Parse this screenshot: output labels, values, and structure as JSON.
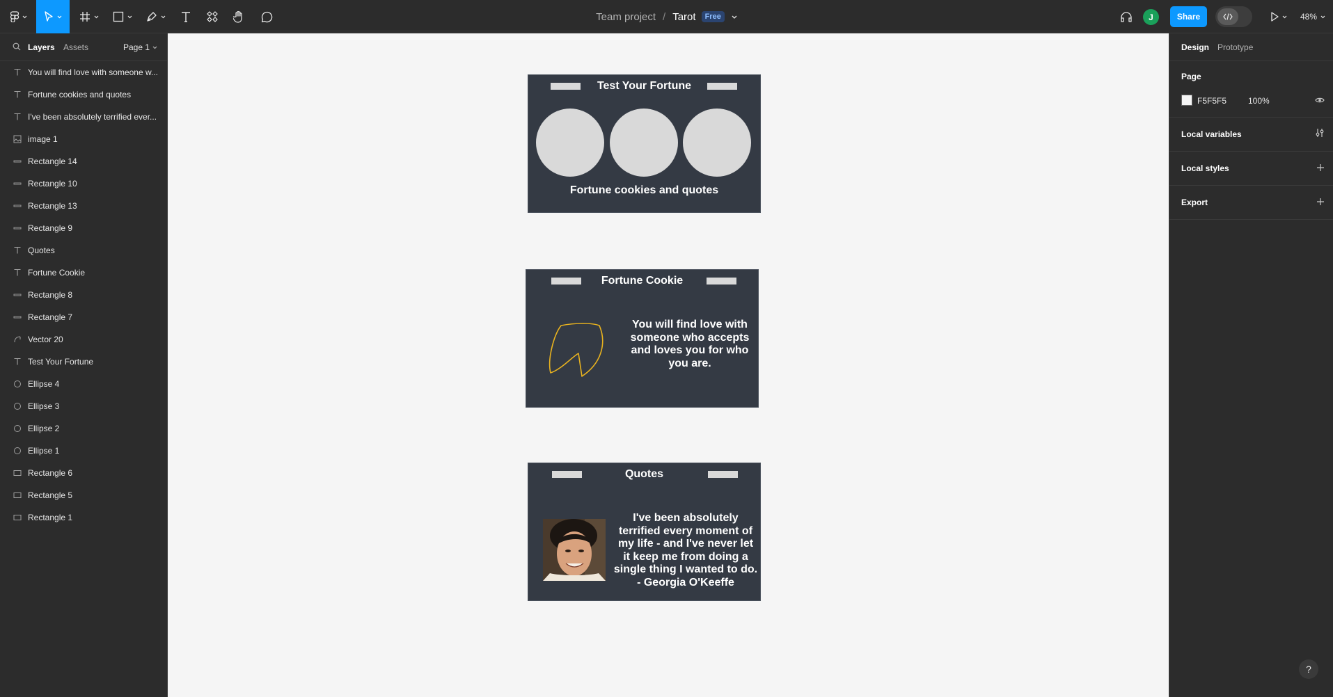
{
  "toolbar": {
    "tools": [
      "main-menu",
      "move",
      "frame",
      "shape",
      "pen",
      "text",
      "resources",
      "hand",
      "comment"
    ],
    "team": "Team project",
    "separator": "/",
    "file_name": "Tarot",
    "plan_badge": "Free",
    "avatar_initial": "J",
    "share_label": "Share",
    "zoom": "48%"
  },
  "left_panel": {
    "tabs": {
      "layers": "Layers",
      "assets": "Assets"
    },
    "page_selector": "Page 1",
    "layers": [
      {
        "type": "text",
        "name": "You will find love with someone w..."
      },
      {
        "type": "text",
        "name": "Fortune cookies and quotes"
      },
      {
        "type": "text",
        "name": "I've been absolutely terrified ever..."
      },
      {
        "type": "image",
        "name": "image 1"
      },
      {
        "type": "line",
        "name": "Rectangle 14"
      },
      {
        "type": "line",
        "name": "Rectangle 10"
      },
      {
        "type": "line",
        "name": "Rectangle 13"
      },
      {
        "type": "line",
        "name": "Rectangle 9"
      },
      {
        "type": "text",
        "name": "Quotes"
      },
      {
        "type": "text",
        "name": "Fortune Cookie"
      },
      {
        "type": "line",
        "name": "Rectangle 8"
      },
      {
        "type": "line",
        "name": "Rectangle 7"
      },
      {
        "type": "vector",
        "name": "Vector 20"
      },
      {
        "type": "text",
        "name": "Test Your Fortune"
      },
      {
        "type": "ellipse",
        "name": "Ellipse 4"
      },
      {
        "type": "ellipse",
        "name": "Ellipse 3"
      },
      {
        "type": "ellipse",
        "name": "Ellipse 2"
      },
      {
        "type": "ellipse",
        "name": "Ellipse 1"
      },
      {
        "type": "rect",
        "name": "Rectangle 6"
      },
      {
        "type": "rect",
        "name": "Rectangle 5"
      },
      {
        "type": "rect",
        "name": "Rectangle 1"
      }
    ]
  },
  "canvas": {
    "background": "#F5F5F5",
    "frame1": {
      "title": "Test Your Fortune",
      "subtitle": "Fortune cookies and quotes"
    },
    "frame2": {
      "title": "Fortune Cookie",
      "message": "You will find love with someone who accepts and loves you for who you are."
    },
    "frame3": {
      "title": "Quotes",
      "quote": "I've been absolutely terrified every moment of my life - and I've never let it keep me from doing a single thing I wanted to do. - Georgia O'Keeffe"
    }
  },
  "right_panel": {
    "tabs": {
      "design": "Design",
      "prototype": "Prototype"
    },
    "page_heading": "Page",
    "page_color": "F5F5F5",
    "page_opacity": "100%",
    "local_variables": "Local variables",
    "local_styles": "Local styles",
    "export": "Export"
  },
  "help_label": "?"
}
